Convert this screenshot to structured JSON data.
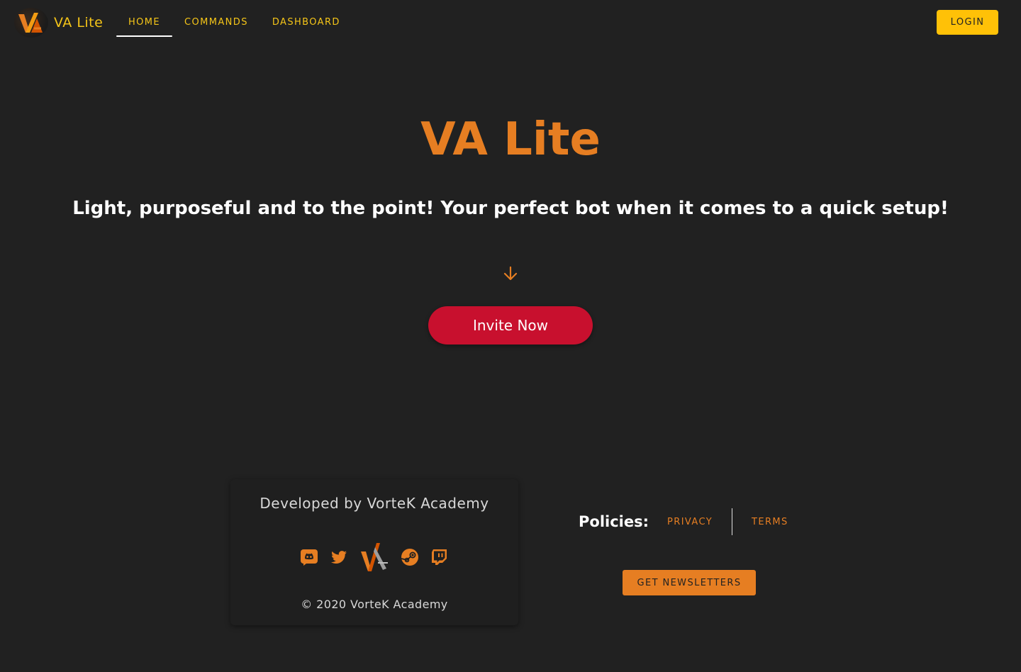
{
  "nav": {
    "brand_name": "VA Lite",
    "links": [
      "HOME",
      "COMMANDS",
      "DASHBOARD"
    ],
    "active": "HOME",
    "login_label": "LOGIN"
  },
  "hero": {
    "title": "VA Lite",
    "subtitle": "Light, purposeful and to the point! Your perfect bot when it comes to a quick setup!",
    "invite_label": "Invite Now"
  },
  "footer": {
    "developed_by": "Developed by VorteK Academy",
    "social_icons": [
      "discord-icon",
      "twitter-icon",
      "vortek-logo-icon",
      "steam-icon",
      "twitch-icon"
    ],
    "copyright": "© 2020 VorteK Academy",
    "policies_label": "Policies:",
    "privacy_label": "PRIVACY",
    "terms_label": "TERMS",
    "newsletter_label": "GET NEWSLETTERS"
  },
  "colors": {
    "background": "#212121",
    "accent_orange": "#e67e22",
    "nav_yellow": "#f5c518",
    "login_yellow": "#ffc107",
    "invite_red": "#c8102e"
  }
}
